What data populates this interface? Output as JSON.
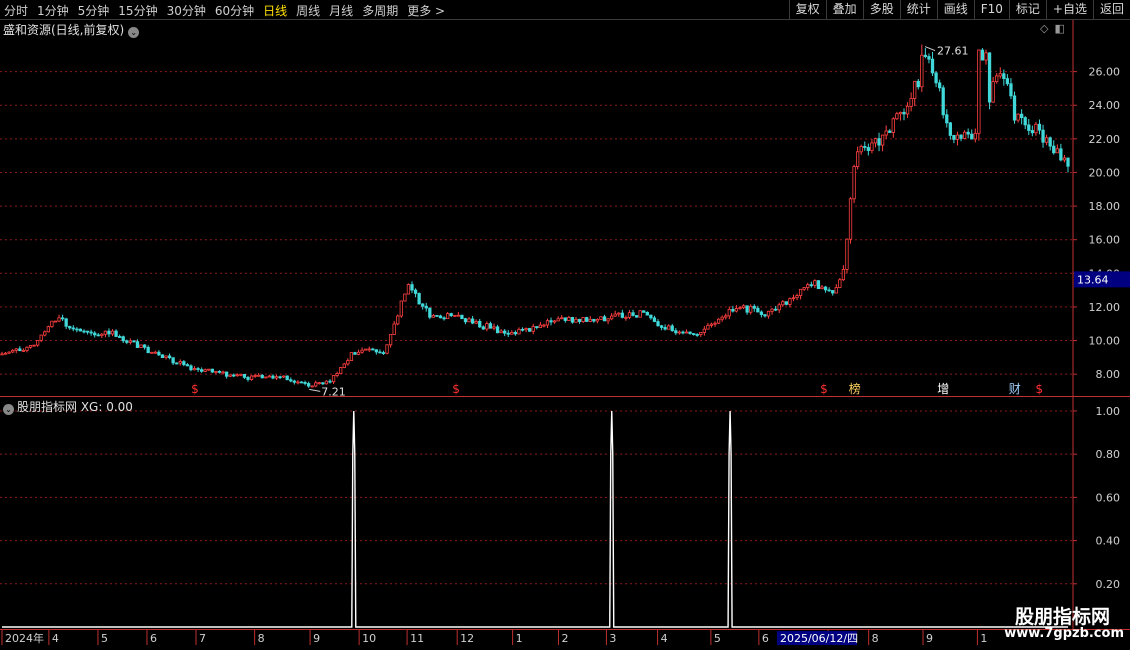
{
  "toolbar": {
    "periods": [
      "分时",
      "1分钟",
      "5分钟",
      "15分钟",
      "30分钟",
      "60分钟",
      "日线",
      "周线",
      "月线",
      "多周期",
      "更多 >"
    ],
    "active_period": "日线",
    "actions": [
      "复权",
      "叠加",
      "多股",
      "统计",
      "画线",
      "F10",
      "标记",
      "+自选",
      "返回"
    ]
  },
  "main_panel": {
    "title": "盛和资源(日线,前复权)",
    "title_icon": "chevron-down-icon",
    "right_icons": [
      "◇",
      "◧"
    ]
  },
  "sub_panel": {
    "title": "股朋指标网 XG: 0.00",
    "title_icon": "chevron-down-icon"
  },
  "colors": {
    "up": "#ff4040",
    "down": "#40d8d8",
    "grid": "#8b1a1a",
    "axis": "#c03030",
    "indicator": "#ffffff",
    "price_label_bg": "#000080"
  },
  "chart_data": [
    {
      "type": "candlestick",
      "ylim": [
        6.7,
        28.0
      ],
      "yticks": [
        "8.00",
        "10.00",
        "12.00",
        "14.00",
        "16.00",
        "18.00",
        "20.00",
        "22.00",
        "24.00",
        "26.00"
      ],
      "current_price": "13.64",
      "max_label": "27.61",
      "min_label": "7.21",
      "events": [
        {
          "label": "$",
          "t": 0.181,
          "color": "#ff3030"
        },
        {
          "label": "$",
          "t": 0.426,
          "color": "#ff3030"
        },
        {
          "label": "$",
          "t": 0.771,
          "color": "#ff3030"
        },
        {
          "label": "榜",
          "t": 0.8,
          "color": "#ffd060"
        },
        {
          "label": "增",
          "t": 0.883,
          "color": "#ffffff"
        },
        {
          "label": "财",
          "t": 0.95,
          "color": "#a0d0ff"
        },
        {
          "label": "$",
          "t": 0.973,
          "color": "#ff3030"
        }
      ],
      "anchors": [
        [
          0.0,
          9.2
        ],
        [
          0.03,
          9.6
        ],
        [
          0.05,
          11.3
        ],
        [
          0.08,
          10.4
        ],
        [
          0.1,
          10.5
        ],
        [
          0.14,
          9.3
        ],
        [
          0.18,
          8.3
        ],
        [
          0.23,
          7.8
        ],
        [
          0.26,
          7.9
        ],
        [
          0.29,
          7.3
        ],
        [
          0.31,
          7.7
        ],
        [
          0.33,
          9.3
        ],
        [
          0.36,
          9.4
        ],
        [
          0.38,
          13.4
        ],
        [
          0.4,
          11.6
        ],
        [
          0.43,
          11.3
        ],
        [
          0.45,
          10.9
        ],
        [
          0.48,
          10.4
        ],
        [
          0.52,
          11.2
        ],
        [
          0.56,
          11.3
        ],
        [
          0.6,
          11.6
        ],
        [
          0.62,
          10.8
        ],
        [
          0.65,
          10.3
        ],
        [
          0.69,
          12.0
        ],
        [
          0.72,
          11.6
        ],
        [
          0.76,
          13.4
        ],
        [
          0.78,
          12.8
        ],
        [
          0.79,
          14.2
        ],
        [
          0.8,
          21.0
        ],
        [
          0.83,
          22.3
        ],
        [
          0.85,
          24.2
        ],
        [
          0.87,
          27.0
        ],
        [
          0.89,
          22.0
        ],
        [
          0.92,
          22.5
        ],
        [
          0.935,
          26.6
        ],
        [
          0.95,
          23.4
        ],
        [
          0.97,
          22.6
        ],
        [
          1.0,
          20.4
        ]
      ],
      "peaks": [
        [
          0.864,
          27.61
        ],
        [
          0.92,
          27.4
        ]
      ]
    },
    {
      "type": "line",
      "series": [
        {
          "name": "XG",
          "value": "0.00"
        }
      ],
      "ylim": [
        0.0,
        1.06
      ],
      "yticks": [
        "0.20",
        "0.40",
        "0.60",
        "0.80",
        "1.00"
      ],
      "spikes": [
        0.33,
        0.572,
        0.683
      ]
    }
  ],
  "xaxis": {
    "labels": [
      {
        "text": "2024年",
        "t": 0.0
      },
      {
        "text": "4",
        "t": 0.044
      },
      {
        "text": "5",
        "t": 0.09
      },
      {
        "text": "6",
        "t": 0.136
      },
      {
        "text": "7",
        "t": 0.182
      },
      {
        "text": "8",
        "t": 0.237
      },
      {
        "text": "9",
        "t": 0.289
      },
      {
        "text": "10",
        "t": 0.335
      },
      {
        "text": "11",
        "t": 0.38
      },
      {
        "text": "12",
        "t": 0.427
      },
      {
        "text": "1",
        "t": 0.479
      },
      {
        "text": "2",
        "t": 0.522
      },
      {
        "text": "3",
        "t": 0.567
      },
      {
        "text": "4",
        "t": 0.615
      },
      {
        "text": "5",
        "t": 0.665
      },
      {
        "text": "6",
        "t": 0.71
      },
      {
        "text": "7",
        "t": 0.775
      },
      {
        "text": "8",
        "t": 0.813
      },
      {
        "text": "9",
        "t": 0.864
      },
      {
        "text": "1",
        "t": 0.915
      }
    ],
    "cursor_date": "2025/06/12/四",
    "cursor_t": 0.727
  },
  "logo": {
    "line1": "股朋指标网",
    "line2": "www.7gpzb.com"
  }
}
